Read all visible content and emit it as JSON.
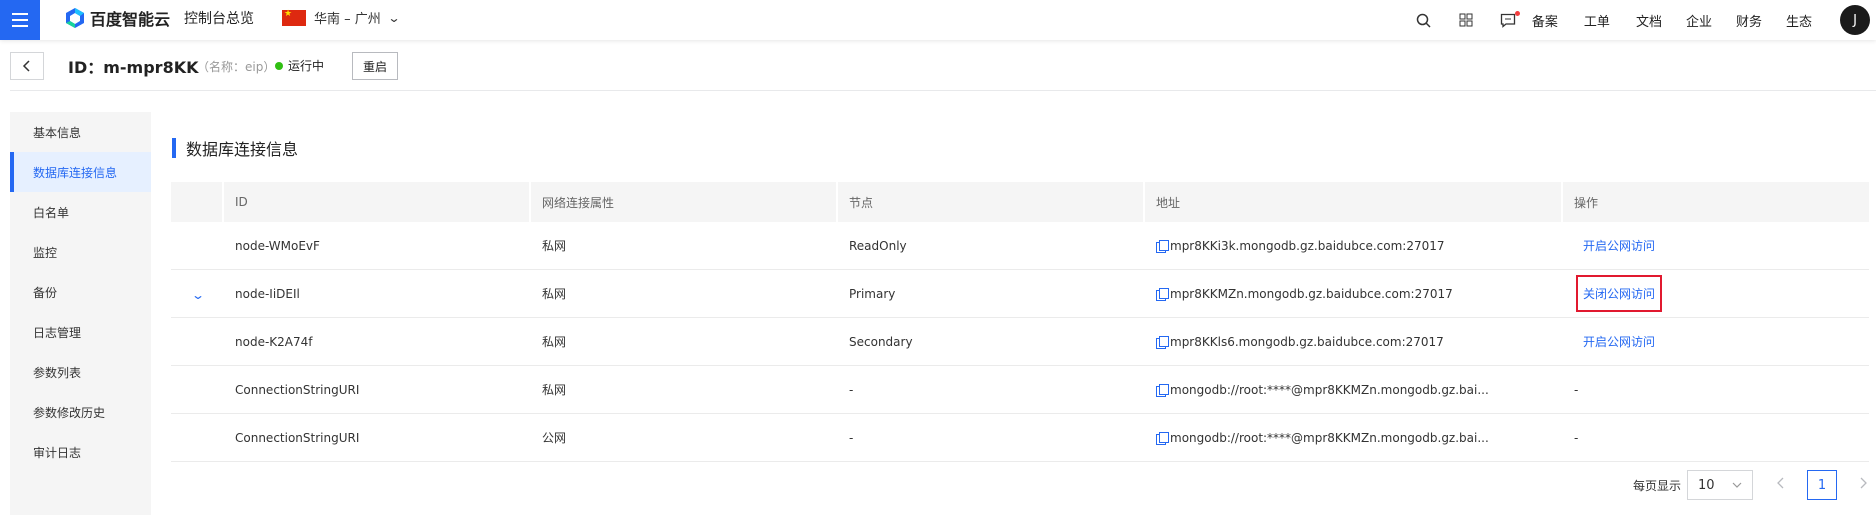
{
  "topbar": {
    "brand": "百度智能云",
    "console_home": "控制台总览",
    "region": "华南 – 广州",
    "links": [
      "备案",
      "工单",
      "文档",
      "企业",
      "财务",
      "生态"
    ],
    "avatar_initial": "J",
    "colors": {
      "accent": "#2468f2",
      "notify_dot": "#f33e3e"
    }
  },
  "header": {
    "title": "ID：m-mpr8KK",
    "subtitle": "（名称：eip）",
    "status": "运行中",
    "status_color": "#30bf13",
    "restart_label": "重启"
  },
  "sidebar": {
    "items": [
      {
        "label": "基本信息",
        "active": false
      },
      {
        "label": "数据库连接信息",
        "active": true
      },
      {
        "label": "白名单",
        "active": false
      },
      {
        "label": "监控",
        "active": false
      },
      {
        "label": "备份",
        "active": false
      },
      {
        "label": "日志管理",
        "active": false
      },
      {
        "label": "参数列表",
        "active": false
      },
      {
        "label": "参数修改历史",
        "active": false
      },
      {
        "label": "审计日志",
        "active": false
      }
    ]
  },
  "section": {
    "title": "数据库连接信息"
  },
  "table": {
    "columns": [
      "ID",
      "网络连接属性",
      "节点",
      "地址",
      "操作"
    ],
    "rows": [
      {
        "id": "node-WMoEvF",
        "network": "私网",
        "node": "ReadOnly",
        "address": "mpr8KKi3k.mongodb.gz.baidubce.com:27017",
        "action": "开启公网访问",
        "expanded": false
      },
      {
        "id": "node-IiDEIl",
        "network": "私网",
        "node": "Primary",
        "address": "mpr8KKMZn.mongodb.gz.baidubce.com:27017",
        "action": "关闭公网访问",
        "expanded": true
      },
      {
        "id": "node-K2A74f",
        "network": "私网",
        "node": "Secondary",
        "address": "mpr8KKls6.mongodb.gz.baidubce.com:27017",
        "action": "开启公网访问",
        "expanded": false
      },
      {
        "id": "ConnectionStringURI",
        "network": "私网",
        "node": "-",
        "address": "mongodb://root:****@mpr8KKMZn.mongodb.gz.bai...",
        "action": "-",
        "expanded": false
      },
      {
        "id": "ConnectionStringURI",
        "network": "公网",
        "node": "-",
        "address": "mongodb://root:****@mpr8KKMZn.mongodb.gz.bai...",
        "action": "-",
        "expanded": false
      }
    ]
  },
  "pagination": {
    "per_page_label": "每页显示",
    "page_size": "10",
    "current_page": "1"
  }
}
